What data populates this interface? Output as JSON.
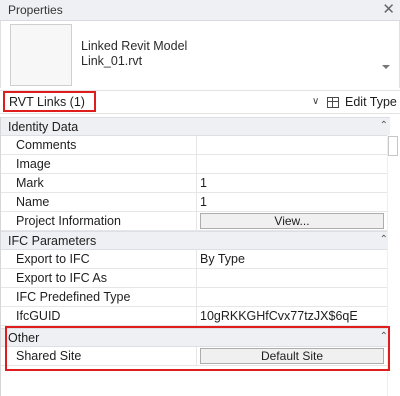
{
  "panel": {
    "title": "Properties",
    "close_glyph": "✕"
  },
  "type_selector": {
    "name_line1": "Linked Revit Model",
    "name_line2": "Link_01.rvt"
  },
  "instance_filter": {
    "label": "RVT Links (1)",
    "edit_type_label": "Edit Type"
  },
  "groups": {
    "identity": {
      "label": "Identity Data",
      "rows": [
        {
          "name": "Comments",
          "value": ""
        },
        {
          "name": "Image",
          "value": ""
        },
        {
          "name": "Mark",
          "value": "1"
        },
        {
          "name": "Name",
          "value": "1"
        },
        {
          "name": "Project Information",
          "button": "View..."
        }
      ]
    },
    "ifc": {
      "label": "IFC Parameters",
      "rows": [
        {
          "name": "Export to IFC",
          "value": "By Type"
        },
        {
          "name": "Export to IFC As",
          "value": ""
        },
        {
          "name": "IFC Predefined Type",
          "value": ""
        },
        {
          "name": "IfcGUID",
          "value": "10gRKKGHfCvx77tzJX$6qE"
        }
      ]
    },
    "other": {
      "label": "Other",
      "rows": [
        {
          "name": "Shared Site",
          "button": "Default Site"
        }
      ]
    }
  },
  "colors": {
    "highlight": "#e01d1d",
    "group_bg": "#eef0f3"
  }
}
